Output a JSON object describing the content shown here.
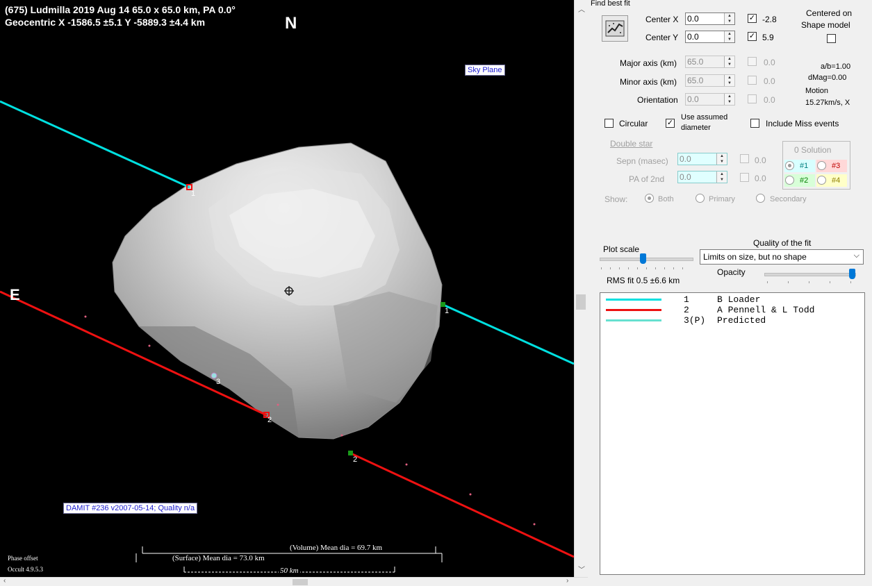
{
  "plot": {
    "title_line1": "(675) Ludmilla  2019 Aug 14   65.0 x 65.0 km, PA 0.0°",
    "title_line2": "Geocentric  X  -1586.5 ±5.1  Y -5889.3 ±4.4 km",
    "north": "N",
    "east": "E",
    "sky_plane": "Sky Plane",
    "damit_label": "DAMIT #236 v2007-05-14; Quality n/a",
    "volume_dia": "(Volume) Mean dia = 69.7 km",
    "surface_dia": "(Surface) Mean dia = 73.0 km",
    "scale_bar": "50 km",
    "phase_offset": "Phase offset",
    "version": "Occult 4.9.5.3",
    "chord_labels": [
      "1",
      "1",
      "2",
      "2",
      "3"
    ]
  },
  "panel": {
    "find_best_fit": "Find best fit",
    "center_x": {
      "label": "Center X",
      "value": "0.0",
      "check_value": "-2.8",
      "checked": true
    },
    "center_y": {
      "label": "Center Y",
      "value": "0.0",
      "check_value": "5.9",
      "checked": true
    },
    "centered_on": "Centered on",
    "shape_model": "Shape model",
    "major_axis": {
      "label": "Major axis (km)",
      "value": "65.0",
      "check_value": "0.0"
    },
    "minor_axis": {
      "label": "Minor axis (km)",
      "value": "65.0",
      "check_value": "0.0"
    },
    "orientation": {
      "label": "Orientation",
      "value": "0.0",
      "check_value": "0.0"
    },
    "ab_ratio": "a/b=1.00",
    "dmag": "dMag=0.00",
    "motion_label": "Motion",
    "motion_value": "15.27km/s, X",
    "circular": "Circular",
    "use_assumed_1": "Use assumed",
    "use_assumed_2": "diameter",
    "include_miss": "Include Miss events",
    "double_star": "Double star",
    "sepn": {
      "label": "Sepn (masec)",
      "value": "0.0",
      "check_value": "0.0"
    },
    "pa2": {
      "label": "PA of 2nd",
      "value": "0.0",
      "check_value": "0.0"
    },
    "show_label": "Show:",
    "show_options": [
      "Both",
      "Primary",
      "Secondary"
    ],
    "solution_title": "0 Solution",
    "solutions": [
      "#1",
      "#3",
      "#2",
      "#4"
    ],
    "plot_scale": "Plot scale",
    "quality_title": "Quality of the fit",
    "quality_value": "Limits on size, but no shape",
    "opacity": "Opacity",
    "rms_fit": "RMS fit  0.5 ±6.6 km"
  },
  "legend": [
    {
      "num": "1",
      "name": "B Loader",
      "color": "#00e0e0"
    },
    {
      "num": "2",
      "name": "A Pennell & L Todd",
      "color": "#ee1111"
    },
    {
      "num": "3(P)",
      "name": "Predicted",
      "color": "#66e0d0"
    }
  ]
}
